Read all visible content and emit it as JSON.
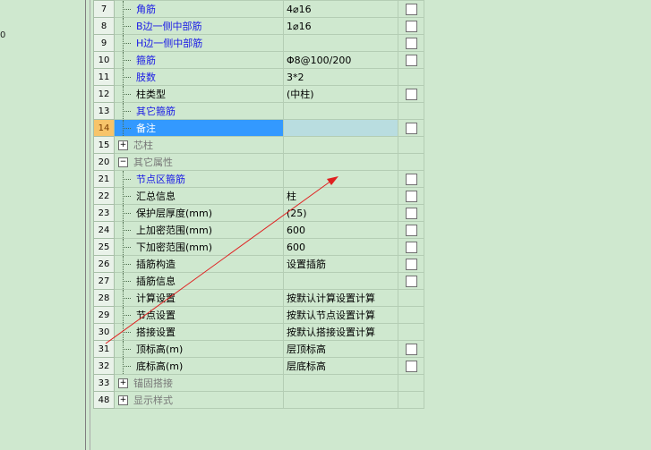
{
  "left_stub": "0",
  "rows": [
    {
      "num": "7",
      "name": "角筋",
      "value": "4⌀16",
      "style": "blue",
      "indent": "leaf",
      "checkbox": true
    },
    {
      "num": "8",
      "name": "B边一侧中部筋",
      "value": "1⌀16",
      "style": "blue",
      "indent": "leaf",
      "checkbox": true
    },
    {
      "num": "9",
      "name": "H边一侧中部筋",
      "value": "",
      "style": "blue",
      "indent": "leaf",
      "checkbox": true
    },
    {
      "num": "10",
      "name": "箍筋",
      "value": "Φ8@100/200",
      "style": "blue",
      "indent": "leaf",
      "checkbox": true
    },
    {
      "num": "11",
      "name": "肢数",
      "value": "3*2",
      "style": "blue",
      "indent": "leaf",
      "checkbox": false
    },
    {
      "num": "12",
      "name": "柱类型",
      "value": "(中柱)",
      "style": "normal",
      "indent": "leaf",
      "checkbox": true
    },
    {
      "num": "13",
      "name": "其它箍筋",
      "value": "",
      "style": "blue",
      "indent": "leaf",
      "checkbox": false
    },
    {
      "num": "14",
      "name": "备注",
      "value": "",
      "style": "normal",
      "indent": "leaf",
      "checkbox": true,
      "selected": true
    },
    {
      "num": "15",
      "name": "芯柱",
      "value": "",
      "style": "gray",
      "indent": "group",
      "expander": "+",
      "checkbox": false
    },
    {
      "num": "20",
      "name": "其它属性",
      "value": "",
      "style": "gray",
      "indent": "group",
      "expander": "−",
      "checkbox": false
    },
    {
      "num": "21",
      "name": "节点区箍筋",
      "value": "",
      "style": "blue",
      "indent": "child",
      "checkbox": true
    },
    {
      "num": "22",
      "name": "汇总信息",
      "value": "柱",
      "style": "normal",
      "indent": "child",
      "checkbox": true
    },
    {
      "num": "23",
      "name": "保护层厚度(mm)",
      "value": "(25)",
      "style": "normal",
      "indent": "child",
      "checkbox": true
    },
    {
      "num": "24",
      "name": "上加密范围(mm)",
      "value": "600",
      "style": "normal",
      "indent": "child",
      "checkbox": true
    },
    {
      "num": "25",
      "name": "下加密范围(mm)",
      "value": "600",
      "style": "normal",
      "indent": "child",
      "checkbox": true
    },
    {
      "num": "26",
      "name": "插筋构造",
      "value": "设置插筋",
      "style": "normal",
      "indent": "child",
      "checkbox": true
    },
    {
      "num": "27",
      "name": "插筋信息",
      "value": "",
      "style": "normal",
      "indent": "child",
      "checkbox": true
    },
    {
      "num": "28",
      "name": "计算设置",
      "value": "按默认计算设置计算",
      "style": "normal",
      "indent": "child",
      "checkbox": false
    },
    {
      "num": "29",
      "name": "节点设置",
      "value": "按默认节点设置计算",
      "style": "normal",
      "indent": "child",
      "checkbox": false
    },
    {
      "num": "30",
      "name": "搭接设置",
      "value": "按默认搭接设置计算",
      "style": "normal",
      "indent": "child",
      "checkbox": false
    },
    {
      "num": "31",
      "name": "顶标高(m)",
      "value": "层顶标高",
      "style": "normal",
      "indent": "child",
      "checkbox": true
    },
    {
      "num": "32",
      "name": "底标高(m)",
      "value": "层底标高",
      "style": "normal",
      "indent": "child",
      "checkbox": true
    },
    {
      "num": "33",
      "name": "锚固搭接",
      "value": "",
      "style": "gray",
      "indent": "group",
      "expander": "+",
      "checkbox": false
    },
    {
      "num": "48",
      "name": "显示样式",
      "value": "",
      "style": "gray",
      "indent": "group",
      "expander": "+",
      "checkbox": false
    }
  ],
  "annotation_color": "#e02020"
}
